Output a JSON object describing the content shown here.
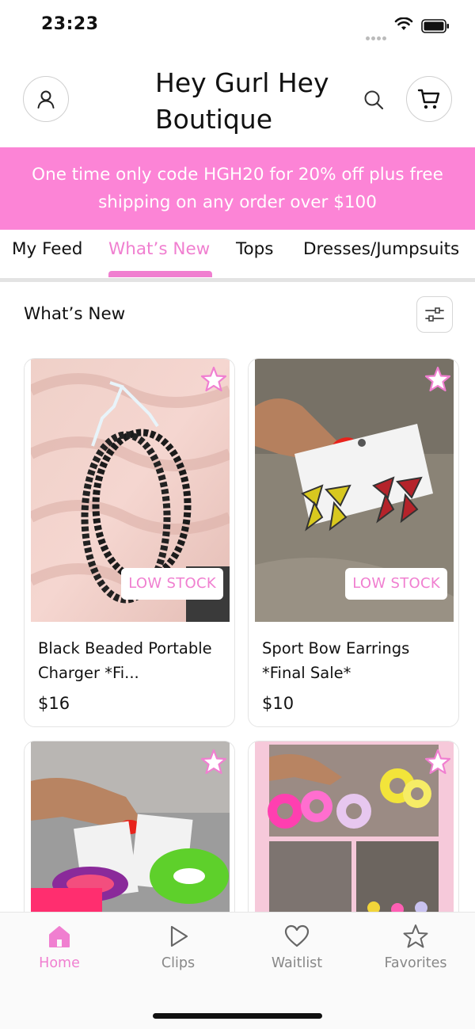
{
  "status_bar": {
    "time": "23:23"
  },
  "header": {
    "title": "Hey Gurl Hey Boutique",
    "account_icon": "person-icon",
    "search_icon": "search-icon",
    "cart_icon": "cart-icon"
  },
  "promo": {
    "text": "One time only code HGH20 for 20% off plus free shipping on any order over $100"
  },
  "tabs": [
    {
      "label": "My Feed"
    },
    {
      "label": "What’s New",
      "active": true
    },
    {
      "label": "Tops"
    },
    {
      "label": "Dresses/Jumpsuits"
    }
  ],
  "section": {
    "title": "What’s New",
    "filter_icon": "sliders-icon"
  },
  "products": [
    {
      "name": "Black Beaded Portable Charger *Fi...",
      "price": "$16",
      "badge": "LOW STOCK"
    },
    {
      "name": "Sport Bow Earrings *Final Sale*",
      "price": "$10",
      "badge": "LOW STOCK"
    },
    {
      "name": "",
      "price": "",
      "badge": ""
    },
    {
      "name": "",
      "price": "",
      "badge": ""
    }
  ],
  "bottom_nav": [
    {
      "label": "Home",
      "icon": "home-icon",
      "active": true
    },
    {
      "label": "Clips",
      "icon": "play-icon"
    },
    {
      "label": "Waitlist",
      "icon": "heart-icon"
    },
    {
      "label": "Favorites",
      "icon": "star-icon"
    }
  ],
  "colors": {
    "accent": "#f07fd0",
    "banner": "#fc84d6"
  }
}
